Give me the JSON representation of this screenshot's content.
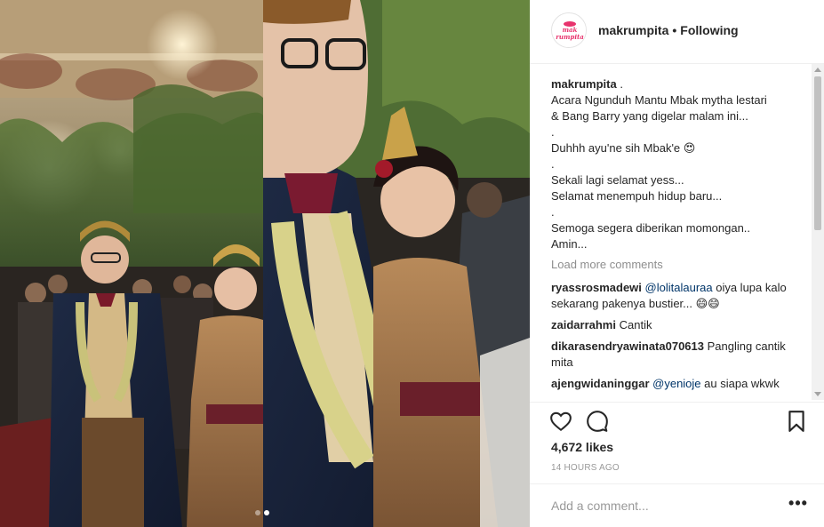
{
  "post": {
    "username": "makrumpita",
    "separator": "•",
    "follow_status": "Following",
    "avatar_logo_text": [
      "mak",
      "rumpita"
    ],
    "caption_user": "makrumpita",
    "caption_first": ".",
    "caption_lines": [
      "Acara Ngunduh Mantu Mbak mytha lestari",
      "& Bang Barry yang digelar malam ini...",
      ".",
      "Duhhh ayu'ne sih Mbak'e 😍",
      ".",
      "Sekali lagi selamat yess...",
      "Selamat menempuh hidup baru...",
      ".",
      "Semoga segera diberikan momongan..",
      "Amin..."
    ],
    "load_more": "Load more comments",
    "comments": [
      {
        "user": "ryassrosmadewi",
        "mention": "@lolitalauraa",
        "text": " oiya lupa kalo sekarang pakenya bustier... 😄😄"
      },
      {
        "user": "zaidarrahmi",
        "mention": "",
        "text": "Cantik"
      },
      {
        "user": "dikarasendryawinata070613",
        "mention": "",
        "text": "Pangling cantik mita"
      },
      {
        "user": "ajengwidaninggar",
        "mention": "@yenioje",
        "text": " au siapa wkwk"
      }
    ],
    "likes": "4,672 likes",
    "time": "14 HOURS AGO",
    "comment_placeholder": "Add a comment...",
    "more_label": "•••"
  },
  "carousel": {
    "count": 2,
    "active": 2
  },
  "icons": {
    "like": "heart-outline-icon",
    "comment": "comment-bubble-icon",
    "save": "bookmark-icon",
    "more": "more-options-icon"
  },
  "colors": {
    "text": "#262626",
    "muted": "#8e8e8e",
    "mention": "#003569",
    "border": "#efefef",
    "brand_pink": "#e8336d"
  }
}
